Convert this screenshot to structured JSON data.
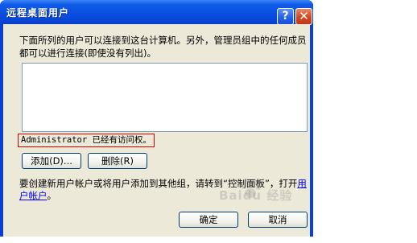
{
  "window": {
    "title": "远程桌面用户",
    "help_glyph": "?",
    "close_glyph": "✕"
  },
  "dialog": {
    "description": "下面所列的用户可以连接到这台计算机。另外，管理员组中的任何成员都可以进行连接(即使没有列出)。",
    "users": [],
    "access_note": "Administrator 已经有访问权。",
    "add_button": "添加(D)...",
    "remove_button": "删除(R)",
    "hint_text": "要创建新用户帐户或将用户添加到其他组，请转到“控制面板”，打开",
    "hint_link": "用户帐户",
    "hint_end": "。",
    "ok_button": "确定",
    "cancel_button": "取消"
  },
  "watermark": {
    "text": "Baidu 经验"
  },
  "colors": {
    "titlebar": "#0a4fe0",
    "dialog_bg": "#ece9d8",
    "highlight_border": "#d40000",
    "link": "#0000ee"
  }
}
